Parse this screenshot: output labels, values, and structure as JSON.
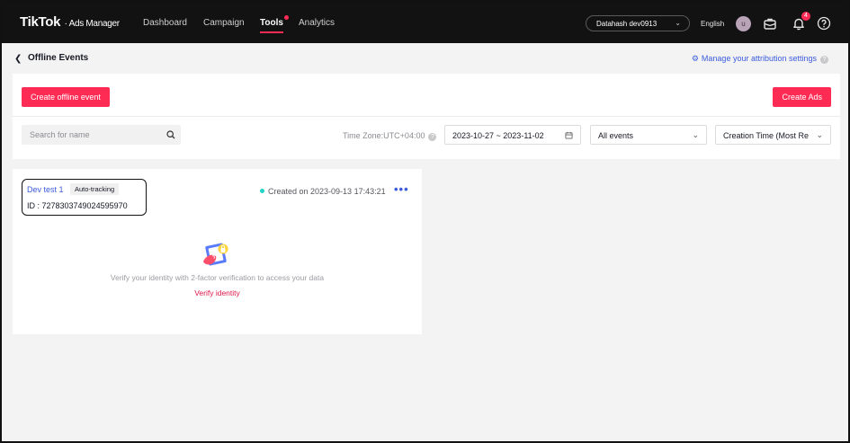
{
  "nav": {
    "logo": "TikTok",
    "logo_sub": "Ads Manager",
    "links": [
      "Dashboard",
      "Campaign",
      "Tools",
      "Analytics"
    ],
    "active_link": "Tools",
    "account": "Datahash dev0913",
    "language": "English",
    "avatar_initial": "u",
    "notification_count": "4"
  },
  "header": {
    "title": "Offline Events",
    "manage_link": "Manage your attribution settings"
  },
  "toolbar": {
    "create_offline_event": "Create offline event",
    "create_ads": "Create Ads",
    "search_placeholder": "Search for name",
    "timezone": "Time Zone:UTC+04:00",
    "date_range": "2023-10-27 ~ 2023-11-02",
    "events_filter": "All events",
    "sort": "Creation Time (Most Re"
  },
  "card": {
    "event_name": "Dev test 1",
    "tag": "Auto-tracking",
    "event_id": "ID : 7278303749024595970",
    "created": "Created on 2023-09-13 17:43:21",
    "verify_message": "Verify your identity with 2-factor verification to access your data",
    "verify_link": "Verify identity"
  },
  "colors": {
    "brand": "#fe2c55",
    "link": "#3b5bdb",
    "nav_bg": "#121212",
    "status_active": "#20d5c5"
  }
}
